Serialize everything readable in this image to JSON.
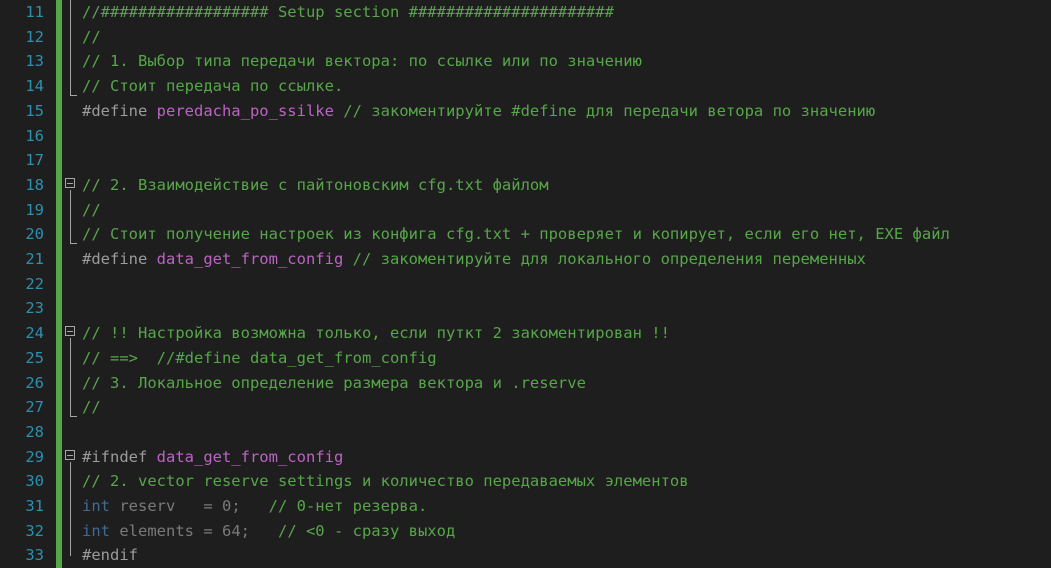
{
  "editor": {
    "lines": [
      {
        "n": "11",
        "parts": [
          {
            "t": "//################## Setup section ######################",
            "c": "c-comment"
          }
        ]
      },
      {
        "n": "12",
        "parts": [
          {
            "t": "//",
            "c": "c-comment"
          }
        ]
      },
      {
        "n": "13",
        "parts": [
          {
            "t": "// 1. Выбор типа передачи вектора: по ссылке или по значению",
            "c": "c-comment"
          }
        ]
      },
      {
        "n": "14",
        "parts": [
          {
            "t": "// Стоит передача по ссылке.",
            "c": "c-comment"
          }
        ]
      },
      {
        "n": "15",
        "parts": [
          {
            "t": "#define ",
            "c": "c-pre"
          },
          {
            "t": "peredacha_po_ssilke",
            "c": "c-macro"
          },
          {
            "t": " // закоментируйте #define для передачи ветора по значению",
            "c": "c-comment"
          }
        ]
      },
      {
        "n": "16",
        "parts": []
      },
      {
        "n": "17",
        "parts": []
      },
      {
        "n": "18",
        "parts": [
          {
            "t": "// 2. Взаимодействие с пайтоновским cfg.txt файлом",
            "c": "c-comment"
          }
        ]
      },
      {
        "n": "19",
        "parts": [
          {
            "t": "//",
            "c": "c-comment"
          }
        ]
      },
      {
        "n": "20",
        "parts": [
          {
            "t": "// Стоит получение настроек из конфига cfg.txt + проверяет и копирует, если его нет, EXE файл",
            "c": "c-comment"
          }
        ]
      },
      {
        "n": "21",
        "parts": [
          {
            "t": "#define ",
            "c": "c-pre"
          },
          {
            "t": "data_get_from_config",
            "c": "c-macro"
          },
          {
            "t": " // закоментируйте для локального определения переменных",
            "c": "c-comment"
          }
        ]
      },
      {
        "n": "22",
        "parts": []
      },
      {
        "n": "23",
        "parts": []
      },
      {
        "n": "24",
        "parts": [
          {
            "t": "// !! Настройка возможна только, если путкт 2 закоментирован !!",
            "c": "c-comment"
          }
        ]
      },
      {
        "n": "25",
        "parts": [
          {
            "t": "// ==>  //#define data_get_from_config",
            "c": "c-comment"
          }
        ]
      },
      {
        "n": "26",
        "parts": [
          {
            "t": "// 3. Локальное определение размера вектора и .reserve",
            "c": "c-comment"
          }
        ]
      },
      {
        "n": "27",
        "parts": [
          {
            "t": "//",
            "c": "c-comment"
          }
        ]
      },
      {
        "n": "28",
        "parts": []
      },
      {
        "n": "29",
        "parts": [
          {
            "t": "#ifndef ",
            "c": "c-pre"
          },
          {
            "t": "data_get_from_config",
            "c": "c-macro"
          }
        ]
      },
      {
        "n": "30",
        "parts": [
          {
            "t": "// 2. vector reserve settings и количество передаваемых элементов",
            "c": "c-comment"
          }
        ]
      },
      {
        "n": "31",
        "parts": [
          {
            "t": "int",
            "c": "c-dimkw"
          },
          {
            "t": " reserv   = 0;   ",
            "c": "c-dim"
          },
          {
            "t": "// 0-нет резерва.",
            "c": "c-comment"
          }
        ]
      },
      {
        "n": "32",
        "parts": [
          {
            "t": "int",
            "c": "c-dimkw"
          },
          {
            "t": " elements = 64;   ",
            "c": "c-dim"
          },
          {
            "t": "// <0 - сразу выход",
            "c": "c-comment"
          }
        ]
      },
      {
        "n": "33",
        "parts": [
          {
            "t": "#endif",
            "c": "c-pre"
          }
        ]
      }
    ]
  }
}
